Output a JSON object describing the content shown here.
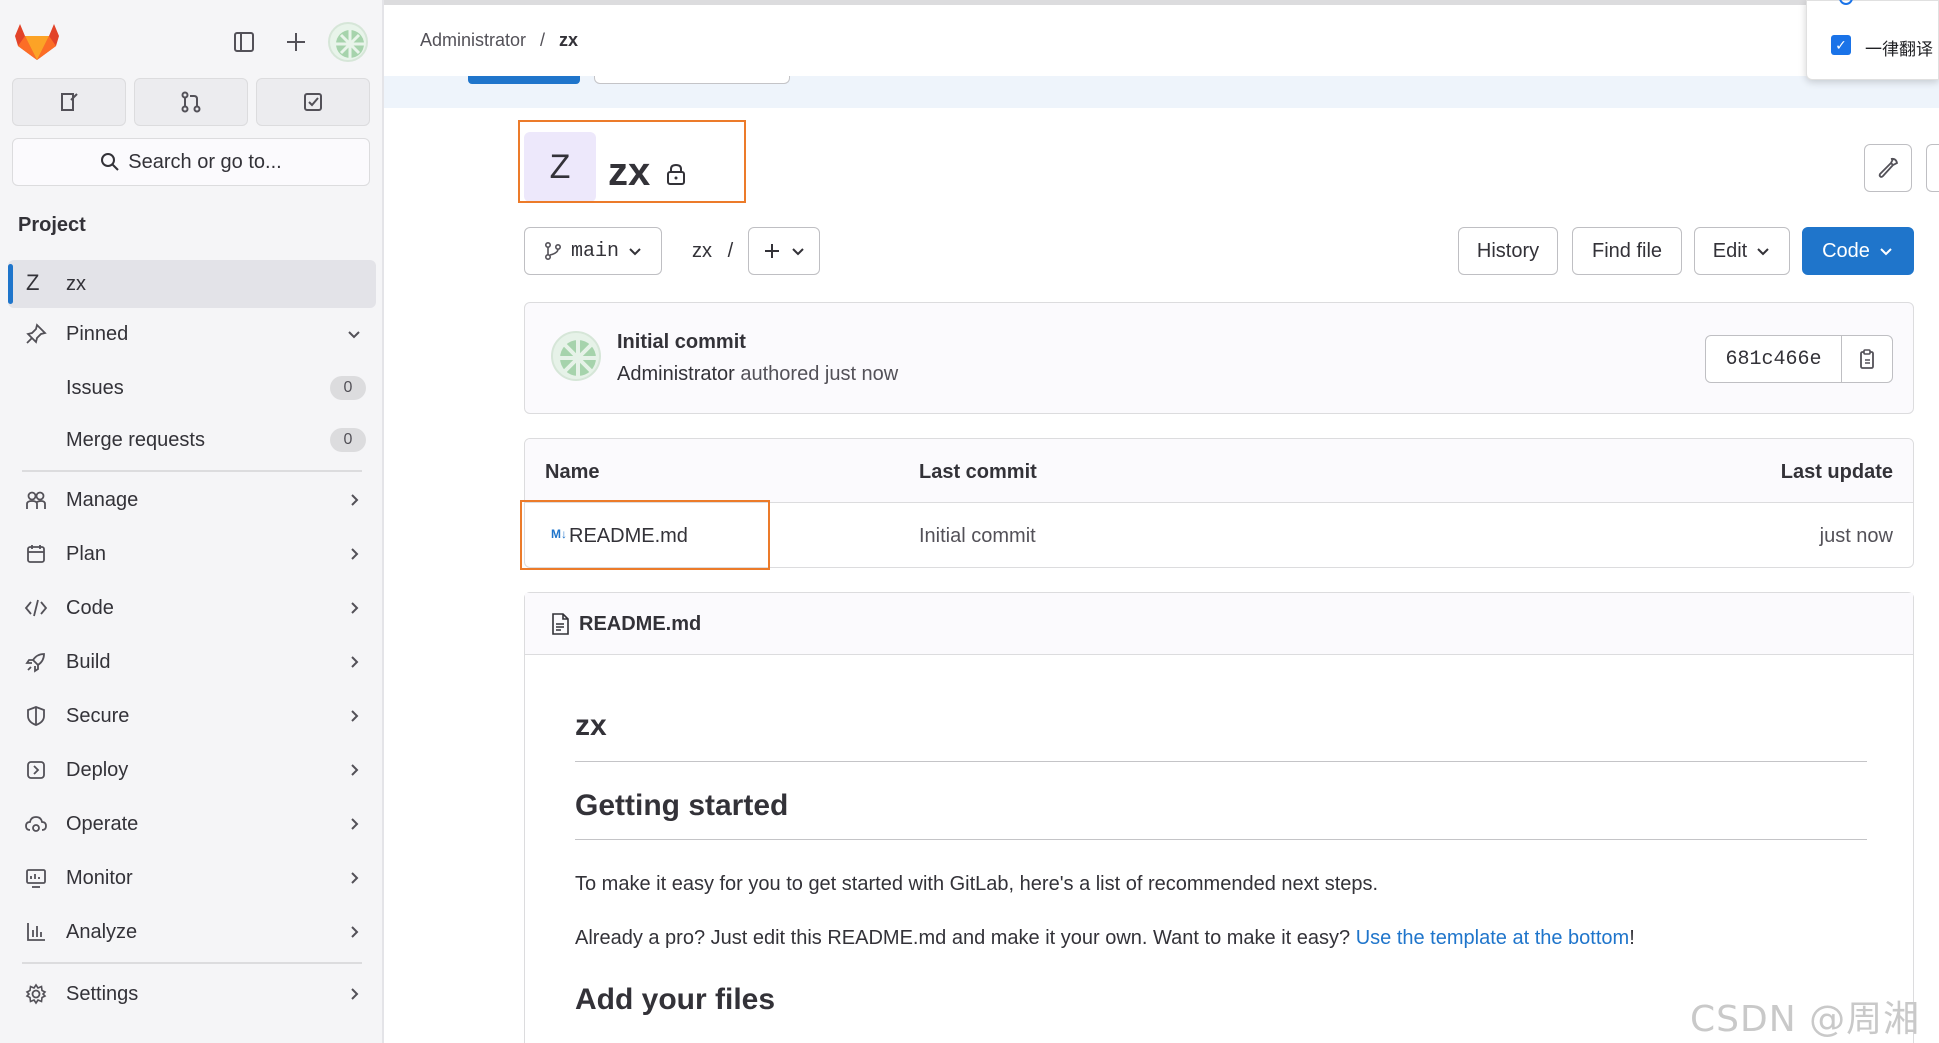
{
  "sidebar": {
    "section_title": "Project",
    "project": {
      "initial": "Z",
      "name": "zx"
    },
    "search_placeholder": "Search or go to...",
    "pinned": {
      "label": "Pinned",
      "items": [
        {
          "label": "Issues",
          "count": "0"
        },
        {
          "label": "Merge requests",
          "count": "0"
        }
      ]
    },
    "nav": [
      {
        "label": "Manage",
        "icon": "users-icon"
      },
      {
        "label": "Plan",
        "icon": "calendar-icon"
      },
      {
        "label": "Code",
        "icon": "code-icon"
      },
      {
        "label": "Build",
        "icon": "rocket-icon"
      },
      {
        "label": "Secure",
        "icon": "shield-icon"
      },
      {
        "label": "Deploy",
        "icon": "deploy-icon"
      },
      {
        "label": "Operate",
        "icon": "cloud-gear-icon"
      },
      {
        "label": "Monitor",
        "icon": "monitor-icon"
      },
      {
        "label": "Analyze",
        "icon": "chart-icon"
      }
    ],
    "settings_label": "Settings"
  },
  "breadcrumb": {
    "parent": "Administrator",
    "separator": "/",
    "current": "zx"
  },
  "translate_popup": {
    "label": "一律翻译"
  },
  "project_header": {
    "initial": "Z",
    "title": "zx"
  },
  "toolbar": {
    "branch": "main",
    "path": "zx",
    "path_sep": "/",
    "history": "History",
    "find_file": "Find file",
    "edit": "Edit",
    "code": "Code"
  },
  "last_commit": {
    "title": "Initial commit",
    "author": "Administrator",
    "meta": " authored just now",
    "sha": "681c466e"
  },
  "files": {
    "headers": {
      "name": "Name",
      "last_commit": "Last commit",
      "last_update": "Last update"
    },
    "rows": [
      {
        "icon": "M↓",
        "name": "README.md",
        "commit": "Initial commit",
        "updated": "just now"
      }
    ]
  },
  "readme": {
    "filename": "README.md",
    "h1": "zx",
    "h2_getting_started": "Getting started",
    "p1": "To make it easy for you to get started with GitLab, here's a list of recommended next steps.",
    "p2_prefix": "Already a pro? Just edit this README.md and make it your own. Want to make it easy? ",
    "p2_link": "Use the template at the bottom",
    "p2_suffix": "!",
    "h2_add_files": "Add your files"
  },
  "watermark": "CSDN @周湘zx",
  "colors": {
    "accent": "#1f75cb",
    "highlight": "#ec7b2a",
    "brand": "#e24329"
  }
}
